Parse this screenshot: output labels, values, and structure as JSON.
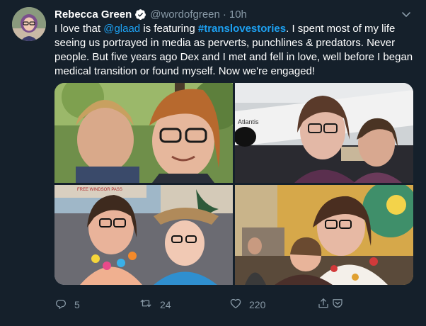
{
  "tweet": {
    "author": {
      "name": "Rebecca Green",
      "handle": "@wordofgreen",
      "separator": "·",
      "time": "10h"
    },
    "text": {
      "p1": "I love that ",
      "mention": "@glaad",
      "p2": " is featuring ",
      "hashtag": "#translovestories",
      "p3": ". I spent most of my life seeing us portrayed in media as perverts, punchlines & predators. Never people. But five years ago Dex and I met and fell in love, well before I began medical transition or found myself. Now we're engaged!"
    },
    "photos": [
      {
        "subject": "couple-selfie-trees"
      },
      {
        "subject": "couple-selfie-space-shuttle-atlantis",
        "sign_text": "Atlantis"
      },
      {
        "subject": "couple-selfie-pride-parade",
        "sign_text": "FREE WINDSOR PASS"
      },
      {
        "subject": "couple-hug-mural-room"
      }
    ],
    "actions": {
      "reply_count": "5",
      "retweet_count": "24",
      "like_count": "220"
    }
  },
  "colors": {
    "background": "#15202b",
    "text": "#ffffff",
    "secondary": "#8899a6",
    "link": "#1da1f2"
  }
}
